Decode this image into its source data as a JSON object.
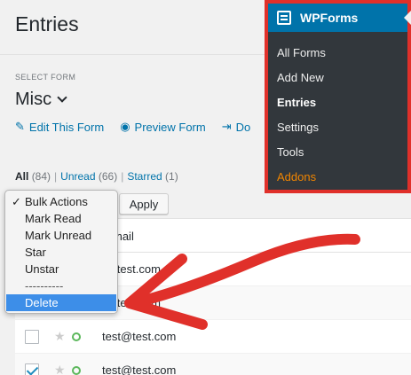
{
  "page": {
    "title": "Entries"
  },
  "select_form": {
    "label": "SELECT FORM",
    "current": "Misc"
  },
  "form_links": {
    "edit": "Edit This Form",
    "preview": "Preview Form",
    "download": "Do"
  },
  "filters": {
    "all": {
      "label": "All",
      "count": "(84)"
    },
    "unread": {
      "label": "Unread",
      "count": "(66)"
    },
    "starred": {
      "label": "Starred",
      "count": "(1)"
    },
    "separator": "|"
  },
  "bulk_actions": {
    "options": [
      "Bulk Actions",
      "Mark Read",
      "Mark Unread",
      "Star",
      "Unstar",
      "----------",
      "Delete"
    ],
    "checkmark": "✓",
    "apply_label": "Apply"
  },
  "table": {
    "header": "mail",
    "rows": [
      {
        "email": "t@test.com",
        "checked": false
      },
      {
        "email": "t@test.com",
        "checked": false
      },
      {
        "email": "test@test.com",
        "checked": false
      },
      {
        "email": "test@test.com",
        "checked": true
      }
    ]
  },
  "wpforms_menu": {
    "title": "WPForms",
    "items": [
      "All Forms",
      "Add New",
      "Entries",
      "Settings",
      "Tools",
      "Addons"
    ],
    "active": "Entries",
    "highlight_color": "#f18500",
    "border_color": "#e0302a"
  },
  "icons": {
    "star": "★",
    "edit": "✎",
    "preview": "◉",
    "download": "⇥"
  }
}
